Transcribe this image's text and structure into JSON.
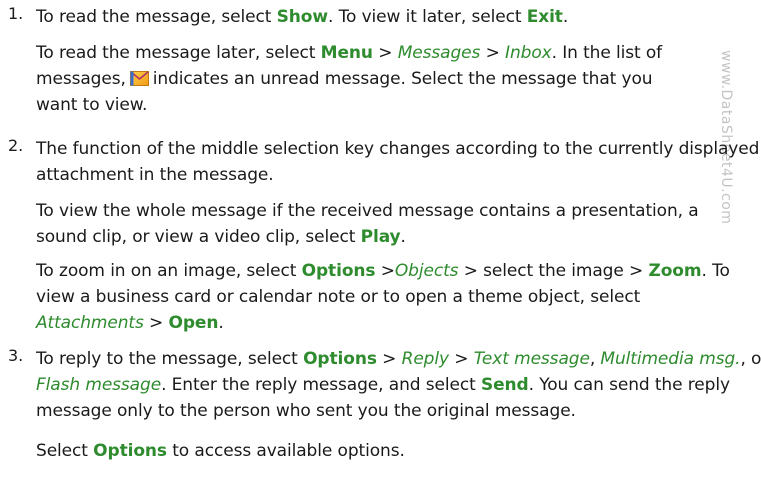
{
  "watermark": "www.DataSheet4U.com",
  "steps": [
    {
      "number": "1.",
      "lead": {
        "t1": "To read the message, select ",
        "show": "Show",
        "t2": ". To view it later, select ",
        "exit": "Exit",
        "t3": "."
      },
      "para": {
        "t1": "To read the message later, select ",
        "menu": "Menu",
        "sep1": " > ",
        "messages": "Messages",
        "sep2": " > ",
        "inbox": "Inbox",
        "t2": ". In the list of messages,",
        "icon": "unread-message-icon",
        "t3": "indicates an unread message. Select the message that you want to view."
      }
    },
    {
      "number": "2.",
      "lead": "The function of the middle selection key changes according to the currently displayed attachment in the message.",
      "para1": {
        "t1": "To view the whole message if the received message contains a presentation, a sound clip, or view a video clip, select ",
        "play": "Play",
        "t2": "."
      },
      "para2": {
        "t1": "To zoom in on an image, select ",
        "options": "Options",
        "sep1": " >",
        "objects": "Objects",
        "t2": " > select the image > ",
        "zoom": "Zoom",
        "t3": ". To view a business card or calendar note or to open a theme object, select ",
        "attachments": "Attachments",
        "sep2": " > ",
        "open": "Open",
        "t4": "."
      }
    },
    {
      "number": "3.",
      "lead": {
        "t1": "To reply to the message, select ",
        "options": "Options",
        "sep1": " > ",
        "reply": "Reply",
        "sep2": " > ",
        "text_message": "Text message",
        "comma1": ", ",
        "multimedia": "Multimedia msg.",
        "comma2": ", or ",
        "flash": "Flash message",
        "t2": ". Enter the reply message, and select ",
        "send": "Send",
        "t3": ". You can send the reply message only to the person who sent you the original message."
      },
      "para": {
        "t1": "Select ",
        "options": "Options",
        "t2": " to access available options."
      }
    }
  ]
}
